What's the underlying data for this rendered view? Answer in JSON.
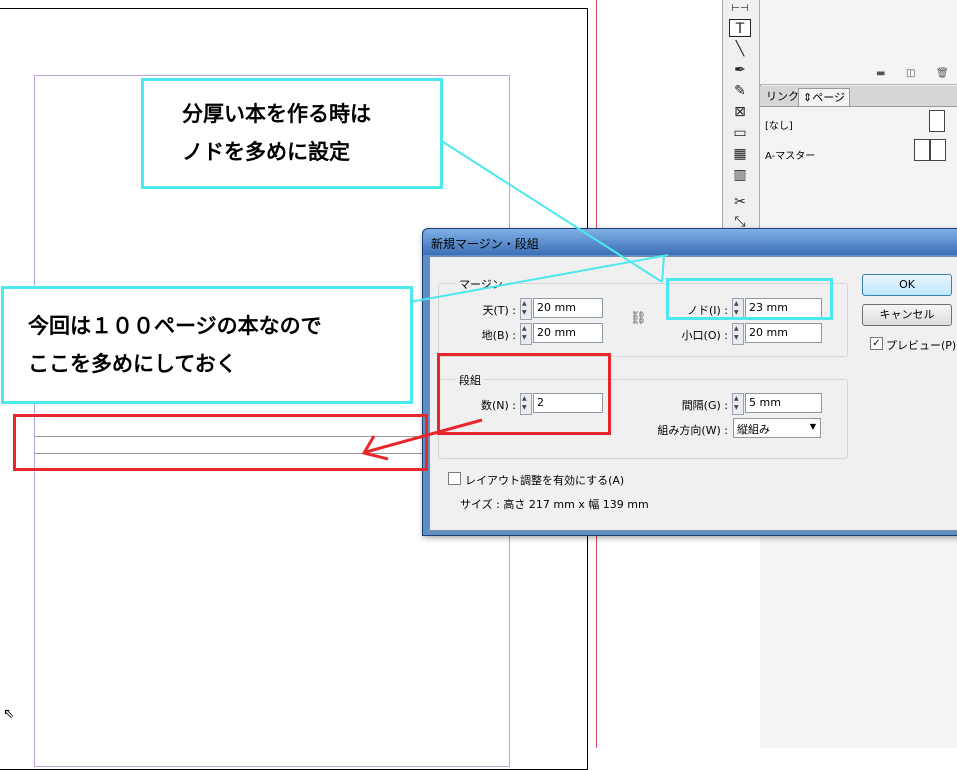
{
  "pages_panel": {
    "tabs": [
      "リンク",
      "⇕ページ"
    ],
    "items": [
      "[なし]",
      "A-マスター"
    ]
  },
  "dialog": {
    "title": "新規マージン・段組",
    "margin_group": {
      "title": "マージン",
      "top_label": "天(T) :",
      "top_value": "20 mm",
      "bottom_label": "地(B) :",
      "bottom_value": "20 mm",
      "inside_label": "ノド(I) :",
      "inside_value": "23 mm",
      "outside_label": "小口(O) :",
      "outside_value": "20 mm"
    },
    "columns_group": {
      "title": "段組",
      "count_label": "数(N) :",
      "count_value": "2",
      "gutter_label": "間隔(G) :",
      "gutter_value": "5 mm",
      "direction_label": "組み方向(W) :",
      "direction_value": "縦組み"
    },
    "layout_adjust_label": "レイアウト調整を有効にする(A)",
    "size_text": "サイズ : 高さ 217 mm x 幅 139 mm",
    "ok_label": "OK",
    "cancel_label": "キャンセル",
    "preview_label": "プレビュー(P)",
    "preview_checked": true
  },
  "annotations": {
    "callout1_line1": "分厚い本を作る時は",
    "callout1_line2": "ノドを多めに設定",
    "callout2_line1": "今回は１００ページの本なので",
    "callout2_line2": "ここを多めにしておく"
  },
  "colors": {
    "callout_border": "#4be8ee",
    "highlight_red": "#e8262b",
    "bleed_guide": "#d54a5a",
    "margin_guide": "#b9a2dd"
  }
}
